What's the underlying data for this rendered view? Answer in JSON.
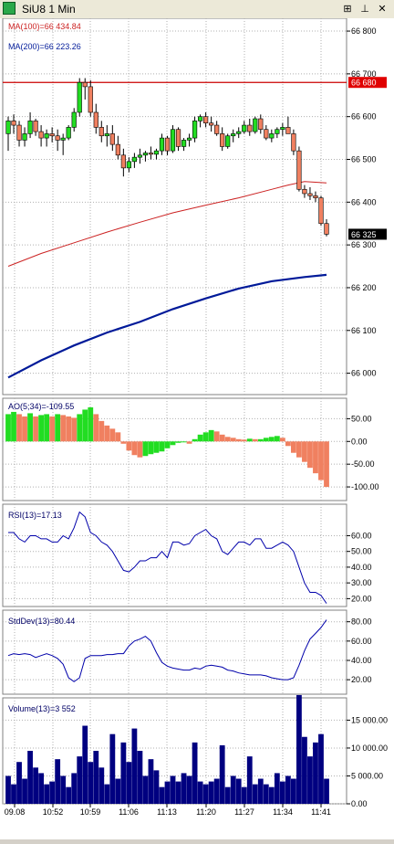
{
  "window": {
    "title": "SiU8 1 Min",
    "icons": [
      "chart-app-icon",
      "dock-icon",
      "pin-icon",
      "close-icon"
    ]
  },
  "colors": {
    "up": "#22dd22",
    "down": "#f08060",
    "ma100": "#cc2222",
    "ma200": "#001a99",
    "hline": "#cc0000",
    "navy": "#000066"
  },
  "chart_data": [
    {
      "type": "candlestick",
      "title": "",
      "ylim": [
        65950,
        66830
      ],
      "y_ticks": [
        {
          "v": 66000,
          "t": "66 000"
        },
        {
          "v": 66100,
          "t": "66 100"
        },
        {
          "v": 66200,
          "t": "66 200"
        },
        {
          "v": 66300,
          "t": "66 300"
        },
        {
          "v": 66400,
          "t": "66 400"
        },
        {
          "v": 66500,
          "t": "66 500"
        },
        {
          "v": 66600,
          "t": "66 600"
        },
        {
          "v": 66700,
          "t": "66 700"
        },
        {
          "v": 66800,
          "t": "66 800"
        }
      ],
      "price_labels": [
        {
          "text": "66 680",
          "value": 66680,
          "color": "#e00000",
          "text_color": "#ffffff"
        },
        {
          "text": "66 325",
          "value": 66325,
          "color": "#000000",
          "text_color": "#ffffff"
        }
      ],
      "horizontal_line": 66680,
      "legend": [
        {
          "label": "MA(100)=66 434.84",
          "color": "#cc2222"
        },
        {
          "label": "MA(200)=66 223.26",
          "color": "#001a99"
        }
      ],
      "candles": [
        [
          66560,
          66600,
          66520,
          66590
        ],
        [
          66590,
          66605,
          66560,
          66580
        ],
        [
          66580,
          66590,
          66530,
          66545
        ],
        [
          66545,
          66575,
          66530,
          66560
        ],
        [
          66560,
          66610,
          66550,
          66590
        ],
        [
          66590,
          66595,
          66555,
          66565
        ],
        [
          66565,
          66580,
          66530,
          66550
        ],
        [
          66550,
          66570,
          66530,
          66560
        ],
        [
          66560,
          66575,
          66540,
          66555
        ],
        [
          66555,
          66570,
          66520,
          66545
        ],
        [
          66545,
          66560,
          66510,
          66550
        ],
        [
          66550,
          66580,
          66545,
          66575
        ],
        [
          66575,
          66620,
          66565,
          66610
        ],
        [
          66610,
          66690,
          66600,
          66680
        ],
        [
          66680,
          66690,
          66640,
          66670
        ],
        [
          66670,
          66685,
          66600,
          66610
        ],
        [
          66610,
          66630,
          66560,
          66575
        ],
        [
          66575,
          66590,
          66540,
          66555
        ],
        [
          66555,
          66580,
          66530,
          66560
        ],
        [
          66560,
          66580,
          66520,
          66535
        ],
        [
          66535,
          66555,
          66500,
          66510
        ],
        [
          66510,
          66525,
          66460,
          66480
        ],
        [
          66480,
          66505,
          66470,
          66495
        ],
        [
          66495,
          66515,
          66480,
          66505
        ],
        [
          66505,
          66525,
          66490,
          66510
        ],
        [
          66510,
          66520,
          66495,
          66515
        ],
        [
          66515,
          66530,
          66500,
          66512
        ],
        [
          66512,
          66525,
          66500,
          66520
        ],
        [
          66520,
          66560,
          66510,
          66550
        ],
        [
          66550,
          66555,
          66510,
          66520
        ],
        [
          66520,
          66580,
          66515,
          66570
        ],
        [
          66570,
          66575,
          66520,
          66530
        ],
        [
          66530,
          66550,
          66520,
          66545
        ],
        [
          66545,
          66560,
          66530,
          66550
        ],
        [
          66550,
          66600,
          66540,
          66590
        ],
        [
          66590,
          66605,
          66575,
          66600
        ],
        [
          66600,
          66610,
          66575,
          66585
        ],
        [
          66585,
          66600,
          66565,
          66580
        ],
        [
          66580,
          66590,
          66555,
          66560
        ],
        [
          66560,
          66575,
          66520,
          66530
        ],
        [
          66530,
          66560,
          66525,
          66555
        ],
        [
          66555,
          66570,
          66540,
          66560
        ],
        [
          66560,
          66575,
          66550,
          66565
        ],
        [
          66565,
          66590,
          66560,
          66580
        ],
        [
          66580,
          66595,
          66555,
          66565
        ],
        [
          66565,
          66600,
          66560,
          66595
        ],
        [
          66595,
          66605,
          66560,
          66570
        ],
        [
          66570,
          66580,
          66545,
          66550
        ],
        [
          66550,
          66570,
          66540,
          66560
        ],
        [
          66560,
          66575,
          66550,
          66570
        ],
        [
          66570,
          66585,
          66555,
          66575
        ],
        [
          66575,
          66600,
          66560,
          66560
        ],
        [
          66560,
          66570,
          66510,
          66520
        ],
        [
          66520,
          66530,
          66425,
          66430
        ],
        [
          66430,
          66440,
          66410,
          66420
        ],
        [
          66420,
          66435,
          66405,
          66415
        ],
        [
          66415,
          66425,
          66400,
          66410
        ],
        [
          66410,
          66415,
          66345,
          66350
        ],
        [
          66350,
          66360,
          66320,
          66325
        ]
      ],
      "ma100": [
        [
          0,
          66250
        ],
        [
          6,
          66280
        ],
        [
          12,
          66305
        ],
        [
          18,
          66330
        ],
        [
          24,
          66353
        ],
        [
          30,
          66375
        ],
        [
          36,
          66393
        ],
        [
          42,
          66410
        ],
        [
          48,
          66430
        ],
        [
          51,
          66440
        ],
        [
          54,
          66448
        ],
        [
          58,
          66445
        ]
      ],
      "ma200": [
        [
          0,
          65990
        ],
        [
          6,
          66030
        ],
        [
          12,
          66065
        ],
        [
          18,
          66095
        ],
        [
          24,
          66120
        ],
        [
          30,
          66150
        ],
        [
          36,
          66175
        ],
        [
          42,
          66198
        ],
        [
          48,
          66215
        ],
        [
          54,
          66225
        ],
        [
          58,
          66230
        ]
      ]
    },
    {
      "type": "bar",
      "name": "AO",
      "legend": "AO(5;34)=-109.55",
      "ylim": [
        -130,
        95
      ],
      "y_ticks": [
        {
          "v": 50,
          "t": "50.00"
        },
        {
          "v": 0,
          "t": "0.00"
        },
        {
          "v": -50,
          "t": "-50.00"
        },
        {
          "v": -100,
          "t": "-100.00"
        }
      ],
      "values": [
        60,
        65,
        60,
        55,
        62,
        55,
        58,
        60,
        55,
        60,
        58,
        55,
        52,
        60,
        70,
        75,
        60,
        45,
        35,
        28,
        20,
        -5,
        -20,
        -30,
        -35,
        -32,
        -28,
        -25,
        -22,
        -15,
        -8,
        -3,
        -2,
        -5,
        5,
        15,
        20,
        25,
        22,
        15,
        10,
        8,
        5,
        4,
        6,
        5,
        5,
        8,
        10,
        12,
        8,
        -10,
        -25,
        -35,
        -45,
        -58,
        -70,
        -85,
        -100
      ]
    },
    {
      "type": "line",
      "name": "RSI",
      "legend": "RSI(13)=17.13",
      "ylim": [
        15,
        80
      ],
      "y_ticks": [
        {
          "v": 60,
          "t": "60.00"
        },
        {
          "v": 50,
          "t": "50.00"
        },
        {
          "v": 40,
          "t": "40.00"
        },
        {
          "v": 30,
          "t": "30.00"
        },
        {
          "v": 20,
          "t": "20.00"
        }
      ],
      "values": [
        62,
        62,
        58,
        56,
        60,
        60,
        58,
        58,
        56,
        56,
        60,
        58,
        65,
        75,
        72,
        62,
        60,
        56,
        54,
        50,
        44,
        38,
        37,
        40,
        44,
        44,
        46,
        46,
        50,
        46,
        56,
        56,
        54,
        55,
        60,
        62,
        64,
        60,
        58,
        50,
        48,
        52,
        56,
        56,
        54,
        58,
        58,
        52,
        52,
        54,
        56,
        54,
        50,
        40,
        30,
        24,
        24,
        22,
        17
      ]
    },
    {
      "type": "line",
      "name": "StdDev",
      "legend": "StdDev(13)=80.44",
      "ylim": [
        5,
        92
      ],
      "y_ticks": [
        {
          "v": 80,
          "t": "80.00"
        },
        {
          "v": 60,
          "t": "60.00"
        },
        {
          "v": 40,
          "t": "40.00"
        },
        {
          "v": 20,
          "t": "20.00"
        }
      ],
      "values": [
        45,
        47,
        46,
        47,
        46,
        43,
        45,
        47,
        45,
        42,
        36,
        22,
        18,
        22,
        42,
        45,
        45,
        45,
        46,
        46,
        47,
        47,
        55,
        60,
        62,
        65,
        60,
        48,
        38,
        34,
        32,
        31,
        30,
        30,
        32,
        31,
        34,
        35,
        34,
        33,
        30,
        29,
        27,
        26,
        25,
        25,
        25,
        24,
        22,
        21,
        20,
        20,
        22,
        35,
        50,
        62,
        68,
        74,
        82
      ]
    },
    {
      "type": "bar",
      "name": "Volume",
      "legend": "Volume(13)=3 552",
      "ylim": [
        0,
        19000
      ],
      "y_ticks": [
        {
          "v": 15000,
          "t": "15 000.00"
        },
        {
          "v": 10000,
          "t": "10 000.00"
        },
        {
          "v": 5000,
          "t": "5 000.00"
        },
        {
          "v": 0,
          "t": "0.00"
        }
      ],
      "values": [
        5000,
        3500,
        7500,
        4500,
        9500,
        6500,
        5500,
        3500,
        4000,
        8000,
        5000,
        3000,
        5500,
        8500,
        14000,
        7500,
        9500,
        6500,
        3500,
        12500,
        4500,
        11000,
        7500,
        13500,
        9500,
        5000,
        8000,
        6000,
        3000,
        4000,
        5000,
        4000,
        5500,
        5000,
        11000,
        4000,
        3500,
        4000,
        4500,
        10500,
        3000,
        5000,
        4500,
        3000,
        8500,
        3500,
        4500,
        3500,
        3000,
        5500,
        4000,
        5000,
        4500,
        19500,
        12000,
        8500,
        11000,
        12500,
        4500
      ],
      "x_labels": [
        "09.08",
        "10:52",
        "10:59",
        "11:06",
        "11:13",
        "11:20",
        "11:27",
        "11:34",
        "11:41"
      ]
    }
  ]
}
